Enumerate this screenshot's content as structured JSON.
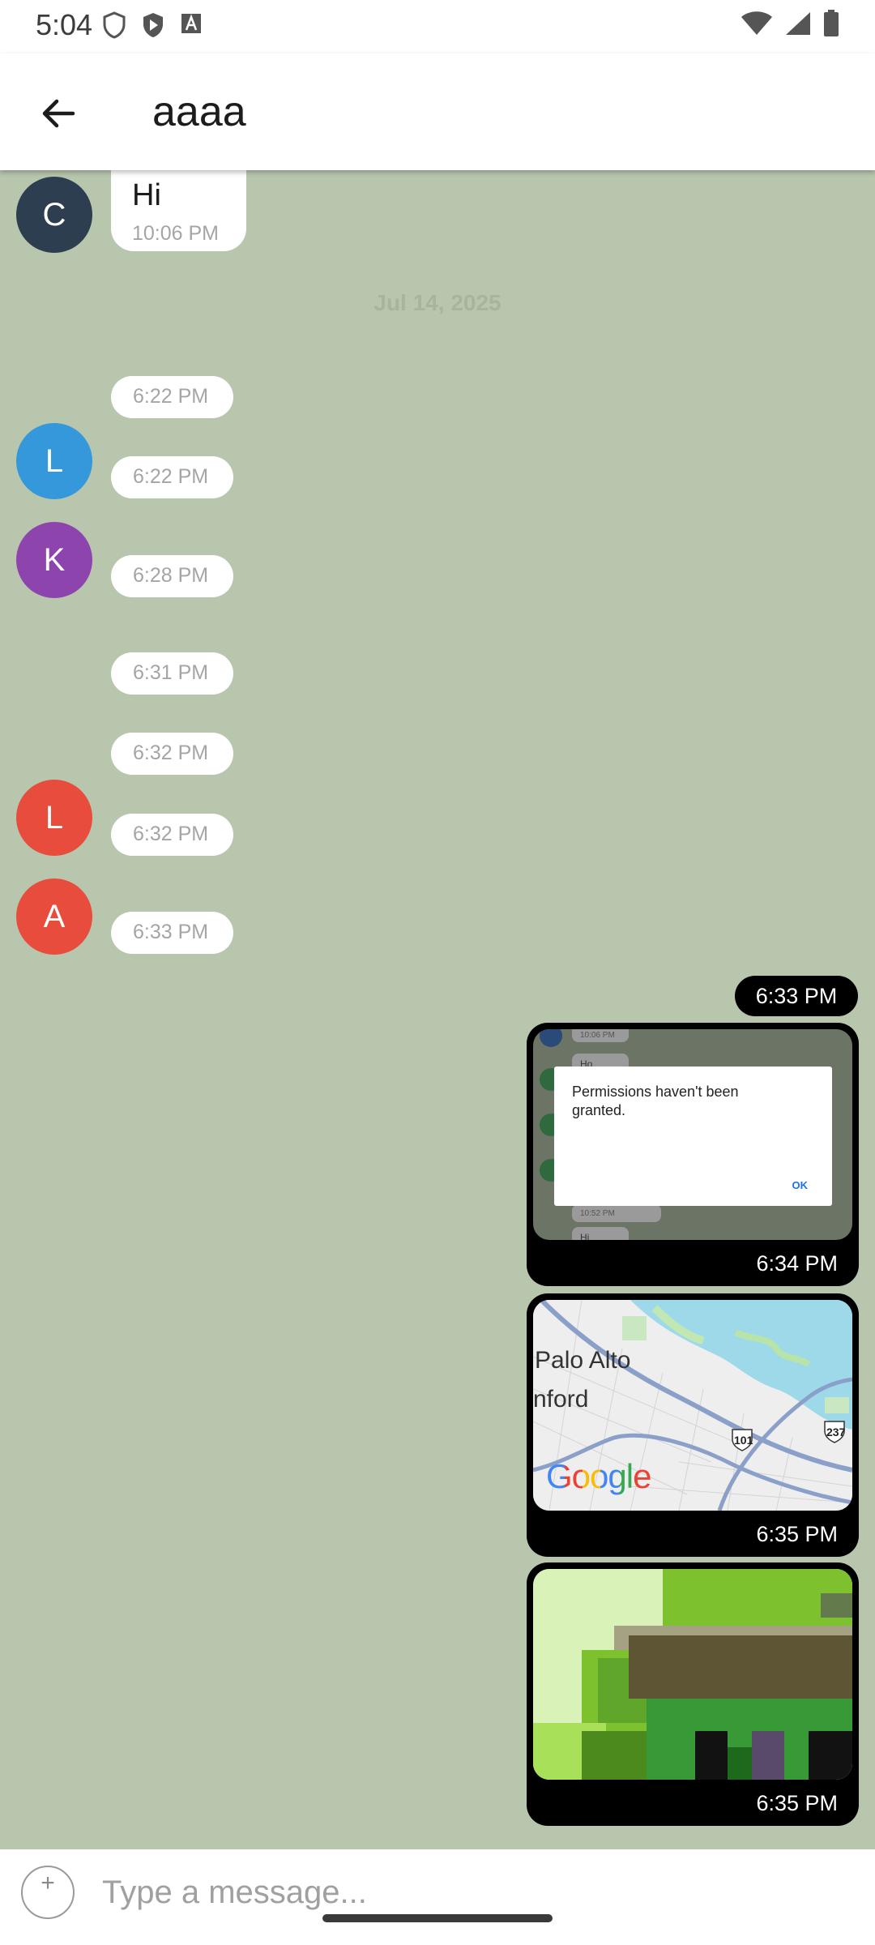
{
  "status_bar": {
    "time": "5:04"
  },
  "app_bar": {
    "title": "aaaa"
  },
  "colors": {
    "chat_background": "#b8c6ad",
    "avatar_c": "#2c3e50",
    "avatar_l_blue": "#3498db",
    "avatar_k": "#8e44ad",
    "avatar_l_red": "#e74c3c",
    "avatar_a": "#e74c3c",
    "outgoing_bubble": "#000000"
  },
  "messages_in": [
    {
      "avatar": "C",
      "text": "Hi",
      "time": "10:06 PM"
    },
    {
      "time": "6:22 PM"
    },
    {
      "avatar": "L",
      "time": "6:22 PM"
    },
    {
      "avatar": "K",
      "time": "6:28 PM"
    },
    {
      "time": "6:31 PM"
    },
    {
      "time": "6:32 PM"
    },
    {
      "avatar": "L",
      "time": "6:32 PM"
    },
    {
      "avatar": "A",
      "time": "6:33 PM"
    }
  ],
  "date_separator": "Jul 14, 2025",
  "messages_out": [
    {
      "time": "6:33 PM"
    },
    {
      "type": "screenshot",
      "time": "6:34 PM",
      "dialog": {
        "text": "Permissions haven't been granted.",
        "ok": "OK"
      },
      "bg_snippets": [
        "10:06 PM",
        "Ho",
        "10:52 PM",
        "Hi"
      ]
    },
    {
      "type": "map",
      "time": "6:35 PM",
      "labels": {
        "city1": "Palo Alto",
        "city2": "nford",
        "hwy1": "101",
        "hwy2": "237",
        "logo": "Google"
      }
    },
    {
      "type": "image",
      "time": "6:35 PM"
    }
  ],
  "input": {
    "placeholder": "Type a message..."
  }
}
